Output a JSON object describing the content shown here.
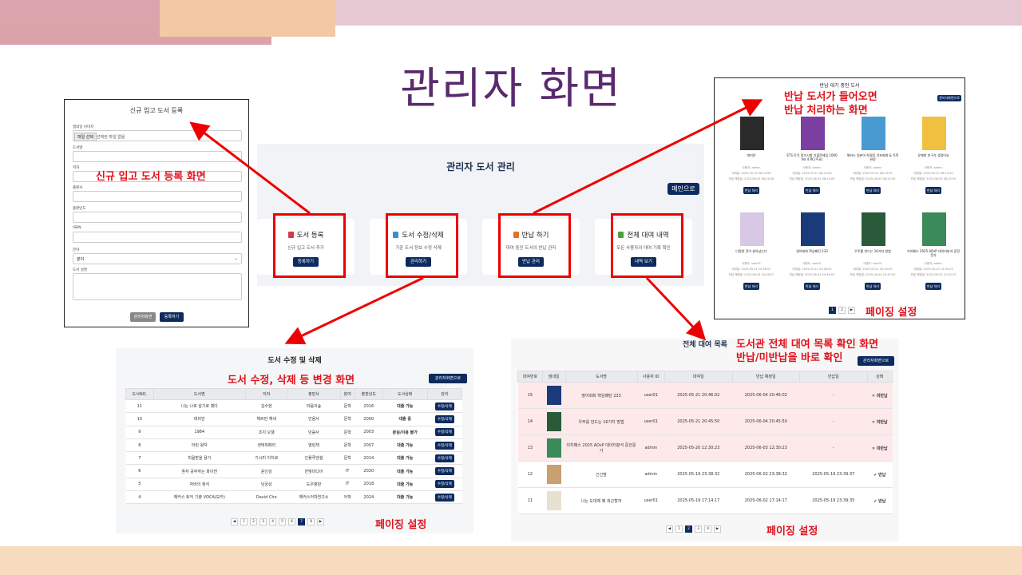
{
  "slide_title": "관리자 화면",
  "colors": {
    "navy": "#0d2b5e",
    "annotation_red": "#e0141e",
    "title_purple": "#5a2a6e"
  },
  "annotations": {
    "register": "신규 입고 도서 등록 화면",
    "return_1": "반납 도서가 들어오면",
    "return_2": "반납 처리하는 화면",
    "return_paging": "페이징 설정",
    "edit": "도서 수정, 삭제 등 변경 화면",
    "edit_paging": "페이징 설정",
    "rental_1": "도서관 전체 대여 목록 확인 화면",
    "rental_2": "반납/미반납을 바로 확인",
    "rental_paging": "페이징 설정"
  },
  "register_form": {
    "title": "신규 입고 도서 등록",
    "thumbnail_label": "썸네일 이미지",
    "file_button": "파일 선택",
    "file_text": "선택된 파일 없음",
    "fields": [
      "도서명",
      "저자",
      "출판사",
      "출판년도",
      "ISBN"
    ],
    "category_label": "분야",
    "category_value": "분야",
    "desc_label": "도서 설명",
    "back_button": "관리자화면",
    "submit_button": "등록하기"
  },
  "admin_main": {
    "title": "관리자 도서 관리",
    "main_button": "메인으로",
    "cards": [
      {
        "title": "도서 등록",
        "desc": "신규 입고 도서 추가",
        "button": "등록하기",
        "icon": "book-red-icon",
        "color": "#d23a4a"
      },
      {
        "title": "도서 수정/삭제",
        "desc": "기존 도서 정보 수정 삭제",
        "button": "관리하기",
        "icon": "book-blue-icon",
        "color": "#3a8fd2"
      },
      {
        "title": "반납 하기",
        "desc": "대여 중인 도서의 반납 관리",
        "button": "반납 관리",
        "icon": "book-orange-icon",
        "color": "#e0702a"
      },
      {
        "title": "전체 대여 내역",
        "desc": "모든 사용자의 대여 기록 확인",
        "button": "내역 보기",
        "icon": "book-green-icon",
        "color": "#4aa040"
      }
    ]
  },
  "return_panel": {
    "title": "반납 대기 중인 도서",
    "admin_button": "관리자화면으로",
    "return_button": "반납 처리",
    "books": [
      {
        "title": "데미안",
        "user": "사용자: admin",
        "date1": "대여일: 2025-05-22 08:24:08",
        "date2": "반납 예정일: 2025-06-05 08:24:08",
        "cover": "#2a2a2a"
      },
      {
        "title": "ETS 토익 정기시험 기출문제집 1000 Vol 4 RC(주요)",
        "user": "사용자: admin",
        "date1": "대여일: 2025-05-22 08:24:09",
        "date2": "반납 예정일: 2025-06-05 08:24:09",
        "cover": "#7a3fa0"
      },
      {
        "title": "해커스 일본어 첫걸음 기초회화 & 독학 완성",
        "user": "사용자: admin",
        "date1": "대여일: 2025-05-22 08:24:09",
        "date2": "반납 예정일: 2025-06-05 08:24:09",
        "cover": "#4a9ad2"
      },
      {
        "title": "유쾌한 친구가 생겼어요",
        "user": "사용자: admin",
        "date1": "대여일: 2025-05-22 08:23:50",
        "date2": "반납 예정일: 2025-06-05 08:23:50",
        "cover": "#f0c040"
      },
      {
        "title": "다정한 것이 살아남는다",
        "user": "사용자: user01",
        "date1": "대여일: 2025-05-21 20:46:07",
        "date2": "반납 예정일: 2025-06-04 20:46:07",
        "cover": "#d7c8e6"
      },
      {
        "title": "영어회화 핵심패턴 233",
        "user": "사용자: user01",
        "date1": "대여일: 2025-05-21 20:46:02",
        "date2": "반납 예정일: 2025-06-04 20:46:02",
        "cover": "#1a3a7a"
      },
      {
        "title": "우주를 만드는 16가지 방법",
        "user": "사용자: user01",
        "date1": "대여일: 2025-05-21 20:45:50",
        "date2": "반납 예정일: 2025-06-04 20:45:50",
        "cover": "#2a5a3a"
      },
      {
        "title": "이지패스 2025 ADsP 데이터분석 준전문가",
        "user": "사용자: admin",
        "date1": "대여일: 2025-05-20 12:30:23",
        "date2": "반납 예정일: 2025-06-03 12:30:23",
        "cover": "#3a8a5a"
      }
    ],
    "pages": [
      "1",
      "2"
    ]
  },
  "edit_panel": {
    "title": "도서 수정 및 삭제",
    "admin_button": "관리자화면으로",
    "headers": [
      "도서NO.",
      "도서명",
      "저자",
      "출판사",
      "분야",
      "출판년도",
      "도서상태",
      "관리"
    ],
    "rows": [
      [
        "11",
        "나는 나로 살기로 했다",
        "김수현",
        "마음의숲",
        "문학",
        "2016",
        "대출 가능"
      ],
      [
        "10",
        "데미안",
        "헤르만 헤세",
        "민음사",
        "문학",
        "2000",
        "대출 중"
      ],
      [
        "9",
        "1984",
        "조지 오웰",
        "민음사",
        "문학",
        "2003",
        "분실/이용 불가"
      ],
      [
        "8",
        "어린 왕자",
        "생텍쥐페리",
        "열린책",
        "문학",
        "2007",
        "대출 가능"
      ],
      [
        "7",
        "미움받을 용기",
        "기시미 이치로",
        "인플루엔셜",
        "문학",
        "2014",
        "대출 가능"
      ],
      [
        "6",
        "혼자 공부하는 파이썬",
        "윤인성",
        "한빛미디어",
        "IT",
        "2020",
        "대출 가능"
      ],
      [
        "5",
        "자바의 정석",
        "남궁성",
        "도우출판",
        "IT",
        "2018",
        "대출 가능"
      ],
      [
        "4",
        "해커스 토익 기출 VOCA(보카)",
        "David Cho",
        "해커스어학연구소",
        "어학",
        "2024",
        "대출 가능"
      ]
    ],
    "row_button": "수정/삭제",
    "pages": [
      "1",
      "2",
      "3",
      "4",
      "5",
      "6",
      "7",
      "8"
    ],
    "active_page": "7"
  },
  "rental_panel": {
    "title": "전체 대여 목록",
    "admin_button": "관리자화면으로",
    "headers": [
      "대여번호",
      "썸네일",
      "도서명",
      "사용자 ID",
      "대여일",
      "반납 예정일",
      "반납일",
      "상태"
    ],
    "rows": [
      {
        "no": "15",
        "title": "영어회화 핵심패턴 233",
        "user": "user01",
        "rent": "2025-05-21 20:46:02",
        "due": "2025-06-04 20:46:02",
        "ret": "-",
        "status": "✕ 미반납",
        "late": true,
        "thumb": "#1a3a7a"
      },
      {
        "no": "14",
        "title": "우주를 만드는 16가지 방법",
        "user": "user01",
        "rent": "2025-05-21 20:45:50",
        "due": "2025-06-04 20:45:50",
        "ret": "-",
        "status": "✕ 미반납",
        "late": true,
        "thumb": "#2a5a3a"
      },
      {
        "no": "13",
        "title": "이지패스 2025 ADsP 데이터분석 준전문가",
        "user": "admin",
        "rent": "2025-05-20 12:30:23",
        "due": "2025-06-03 12:30:23",
        "ret": "-",
        "status": "✕ 미반납",
        "late": true,
        "thumb": "#3a8a5a"
      },
      {
        "no": "12",
        "title": "긴긴밤",
        "user": "admin",
        "rent": "2025-05-19 23:38:32",
        "due": "2025-06-02 23:38:32",
        "ret": "2025-05-19 23:39:37",
        "status": "✔ 반납",
        "late": false,
        "thumb": "#c9a070"
      },
      {
        "no": "11",
        "title": "나는 도대체 왜 피곤할까",
        "user": "user01",
        "rent": "2025-05-19 17:14:17",
        "due": "2025-06-02 17:14:17",
        "ret": "2025-05-19 23:39:35",
        "status": "✔ 반납",
        "late": false,
        "thumb": "#e8e0d0"
      }
    ],
    "pages": [
      "1",
      "2",
      "3",
      "4"
    ],
    "active_page": "2"
  }
}
